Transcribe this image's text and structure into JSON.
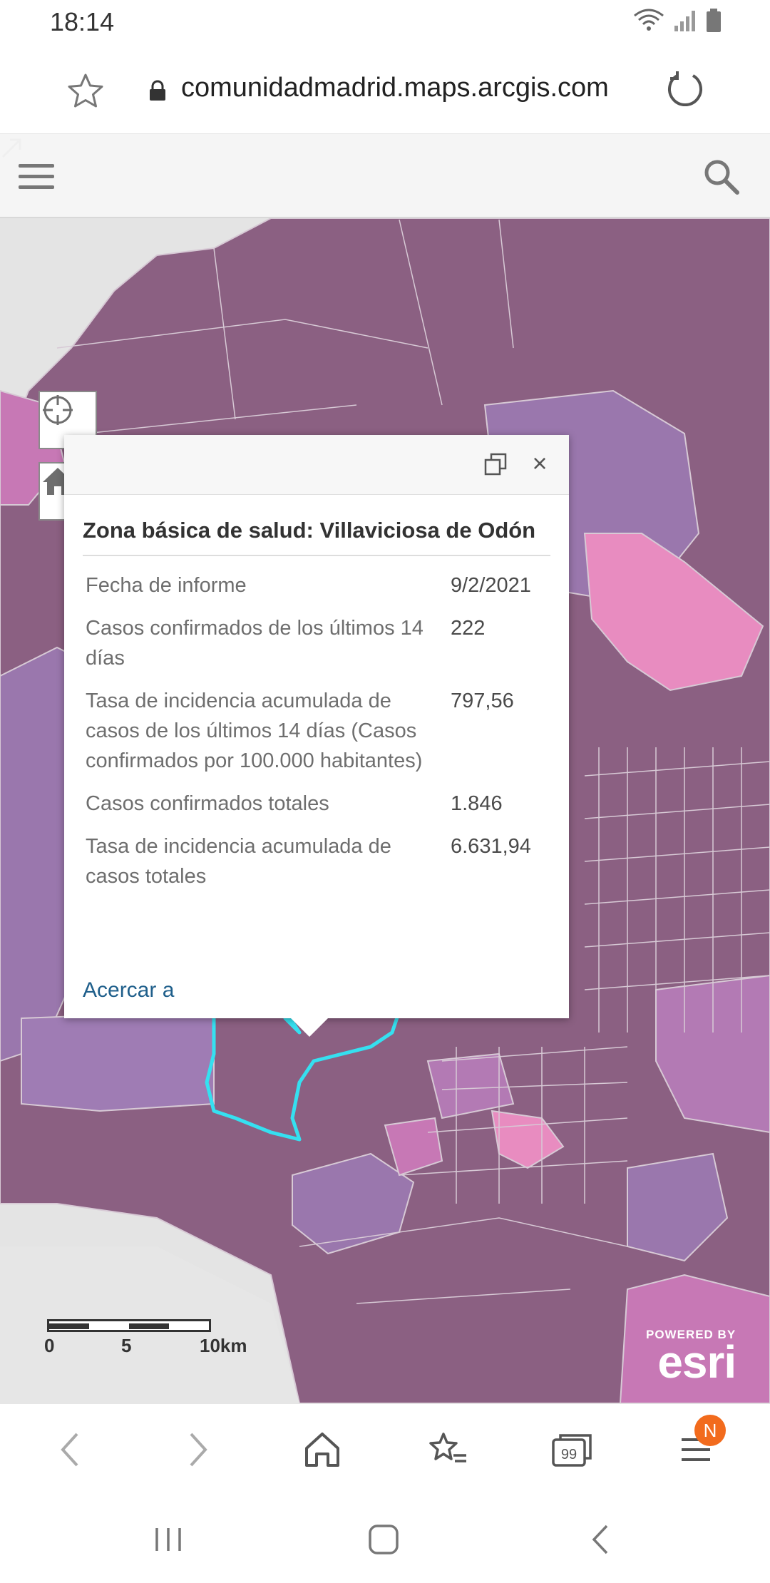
{
  "status_bar": {
    "time": "18:14"
  },
  "browser": {
    "url": "comunidadmadrid.maps.arcgis.com"
  },
  "map": {
    "scale_labels": [
      "0",
      "5",
      "10km"
    ],
    "esri_powered": "POWERED BY",
    "esri_word": "esri"
  },
  "popup": {
    "title": "Zona básica de salud: Villaviciosa de Odón",
    "rows": [
      {
        "label": "Fecha de informe",
        "value": "9/2/2021"
      },
      {
        "label": "Casos confirmados de los últimos 14 días",
        "value": "222"
      },
      {
        "label": "Tasa de incidencia acumulada de casos de los últimos 14 días (Casos confirmados por 100.000 habitantes)",
        "value": "797,56"
      },
      {
        "label": "Casos confirmados totales",
        "value": "1.846"
      },
      {
        "label": "Tasa de incidencia acumulada de casos totales",
        "value": "6.631,94"
      }
    ],
    "zoom_link": "Acercar a",
    "close_glyph": "×"
  },
  "browser_bar": {
    "tabs_count": "99",
    "notification": "N"
  },
  "colors": {
    "region_dark": "#8b6082",
    "region_violet": "#9a77ad",
    "region_pink": "#c778b5",
    "region_light_pink": "#e88cc0",
    "highlight": "#35e0f0",
    "link": "#1f5f8b"
  }
}
